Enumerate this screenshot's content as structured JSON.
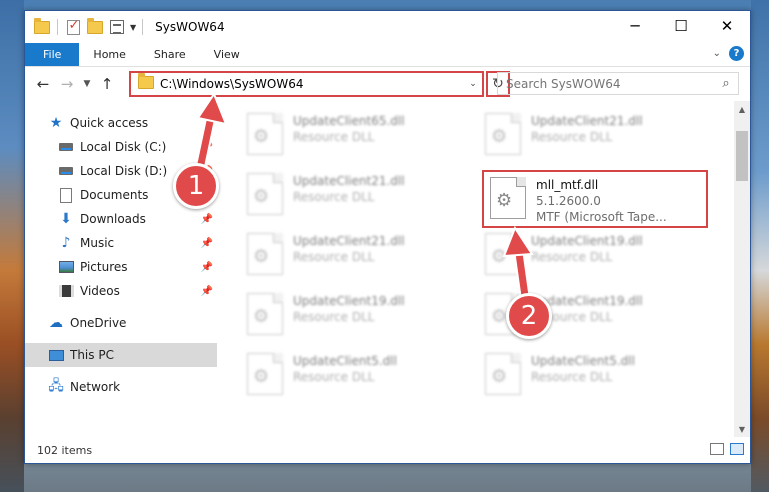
{
  "window": {
    "title": "SysWOW64",
    "controls": {
      "minimize": "─",
      "maximize": "☐",
      "close": "✕"
    }
  },
  "ribbon": {
    "tabs": [
      "File",
      "Home",
      "Share",
      "View"
    ]
  },
  "address": {
    "path": "C:\\Windows\\SysWOW64",
    "search_placeholder": "Search SysWOW64"
  },
  "sidebar": {
    "quick_access": "Quick access",
    "items": [
      {
        "label": "Local Disk (C:)",
        "pinned": true
      },
      {
        "label": "Local Disk (D:)",
        "pinned": true
      },
      {
        "label": "Documents",
        "pinned": true
      },
      {
        "label": "Downloads",
        "pinned": true
      },
      {
        "label": "Music",
        "pinned": true
      },
      {
        "label": "Pictures",
        "pinned": true
      },
      {
        "label": "Videos",
        "pinned": true
      }
    ],
    "onedrive": "OneDrive",
    "this_pc": "This PC",
    "network": "Network"
  },
  "files": {
    "col1": [
      {
        "name": "UpdateClient65.dll",
        "type": "Resource DLL"
      },
      {
        "name": "UpdateClient21.dll",
        "type": "Resource DLL"
      },
      {
        "name": "UpdateClient21.dll",
        "type": "Resource DLL"
      },
      {
        "name": "UpdateClient19.dll",
        "type": "Resource DLL"
      },
      {
        "name": "UpdateClient5.dll",
        "type": "Resource DLL"
      }
    ],
    "col2": [
      {
        "name": "UpdateClient21.dll",
        "type": "Resource DLL"
      },
      {
        "name": "UpdateClient19.dll",
        "type": "Resource DLL"
      },
      {
        "name": "UpdateClient19.dll",
        "type": "Resource DLL"
      },
      {
        "name": "UpdateClient5.dll",
        "type": "Resource DLL"
      }
    ],
    "selected": {
      "name": "mll_mtf.dll",
      "version": "5.1.2600.0",
      "description": "MTF (Microsoft Tape..."
    }
  },
  "status": {
    "item_count": "102 items"
  },
  "annotations": {
    "step1": "1",
    "step2": "2",
    "color": "#e04a4a"
  }
}
